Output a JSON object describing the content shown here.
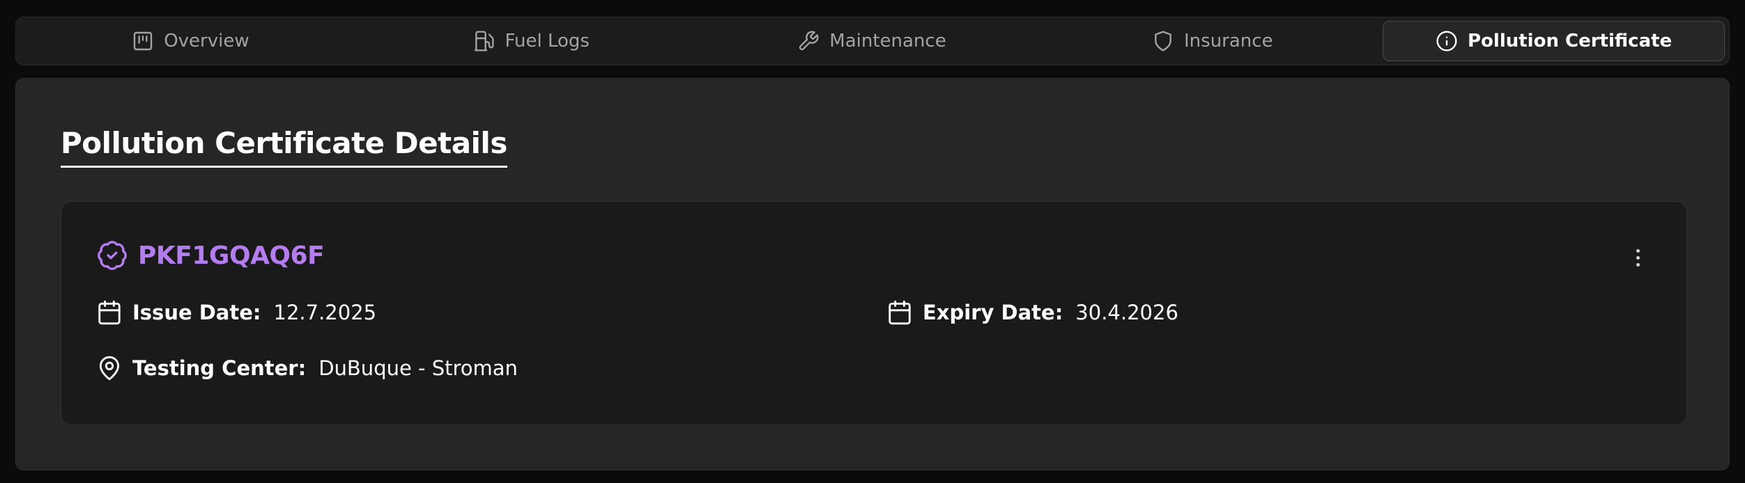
{
  "tabs": [
    {
      "label": "Overview",
      "icon": "chart-icon",
      "active": false
    },
    {
      "label": "Fuel Logs",
      "icon": "fuel-pump-icon",
      "active": false
    },
    {
      "label": "Maintenance",
      "icon": "wrench-icon",
      "active": false
    },
    {
      "label": "Insurance",
      "icon": "shield-icon",
      "active": false
    },
    {
      "label": "Pollution Certificate",
      "icon": "info-icon",
      "active": true
    }
  ],
  "section": {
    "title": "Pollution Certificate Details"
  },
  "certificate": {
    "number": "PKF1GQAQ6F",
    "issue_label": "Issue Date:",
    "issue_value": "12.7.2025",
    "expiry_label": "Expiry Date:",
    "expiry_value": "30.4.2026",
    "center_label": "Testing Center:",
    "center_value": "DuBuque - Stroman"
  },
  "colors": {
    "accent": "#b57bf0",
    "background": "#0b0b0b",
    "panel": "#262626",
    "card": "#1a1a1a"
  }
}
